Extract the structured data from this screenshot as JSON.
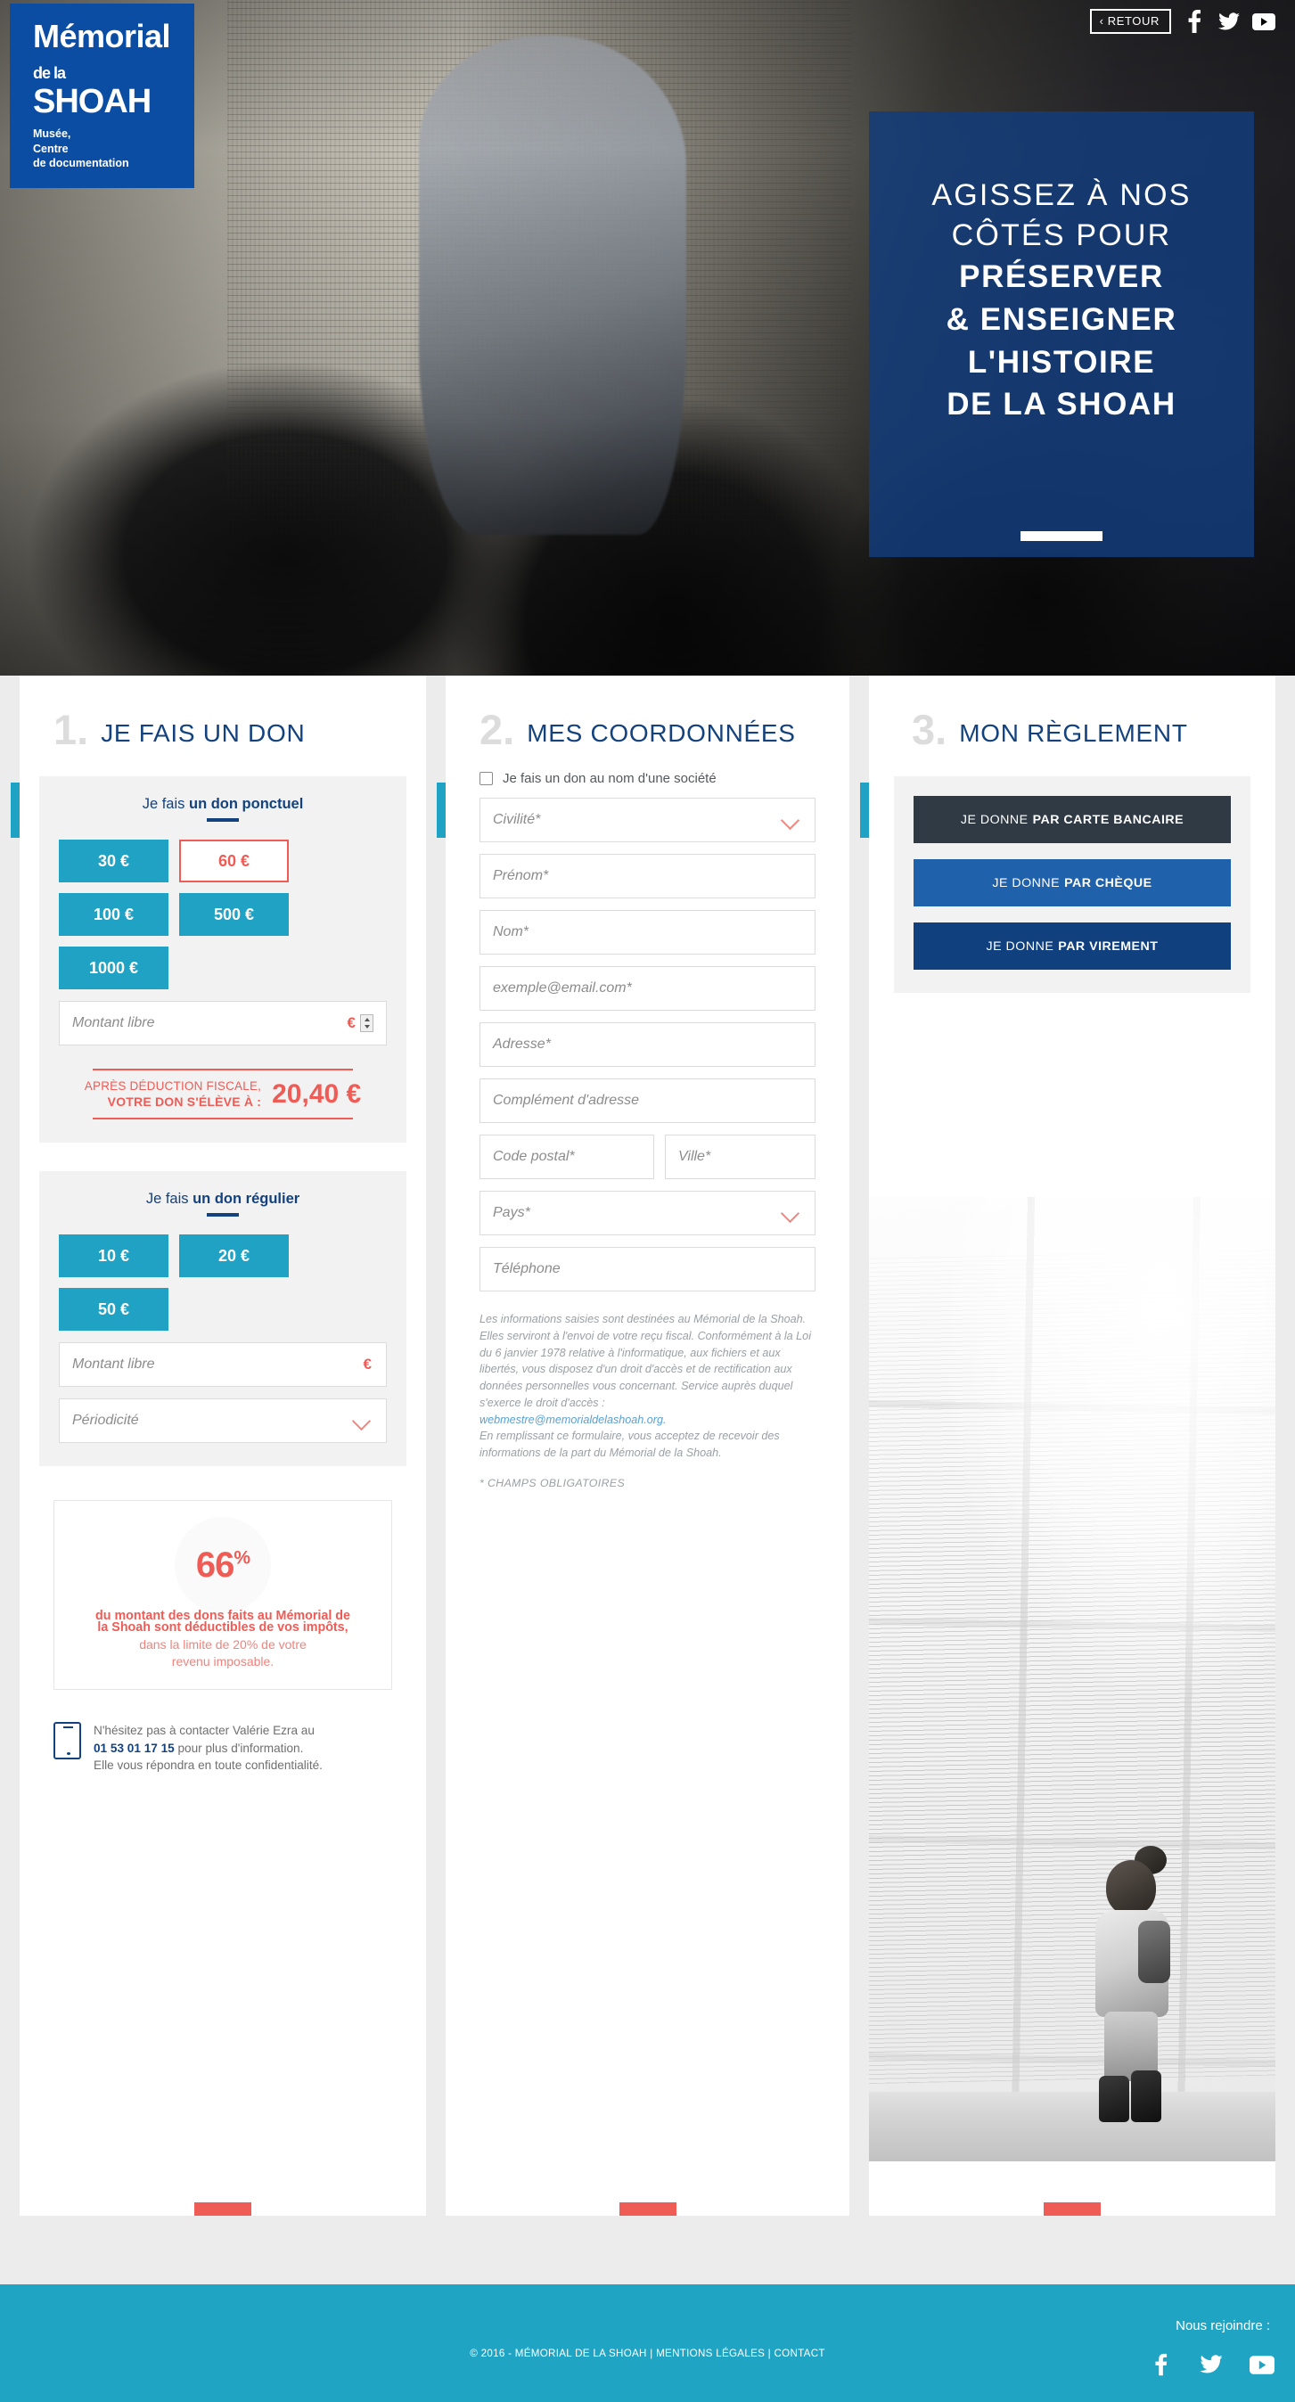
{
  "logo": {
    "line1": "Mémorial",
    "line2_small": "de la",
    "line2_big": "SHOAH",
    "sub_line1": "Musée,",
    "sub_line2": "Centre",
    "sub_line3": "de documentation"
  },
  "topnav": {
    "back_label": "‹ RETOUR",
    "social": [
      "facebook-icon",
      "twitter-icon",
      "youtube-icon"
    ]
  },
  "hero": {
    "line1": "AGISSEZ À NOS",
    "line2": "CÔTÉS POUR",
    "line3": "PRÉSERVER",
    "line4": "& ENSEIGNER",
    "line5": "L'HISTOIRE",
    "line6": "DE LA SHOAH"
  },
  "columns": {
    "col1": {
      "number": "1.",
      "title": "JE FAIS UN DON",
      "one_time": {
        "label_plain": "Je fais ",
        "label_bold": "un don ponctuel",
        "amounts": [
          "30 €",
          "60 €",
          "100 €",
          "500 €",
          "1000 €"
        ],
        "selected": "60 €",
        "free_amount_placeholder": "Montant libre",
        "currency_symbol": "€"
      },
      "deduction": {
        "line1": "APRÈS DÉDUCTION FISCALE,",
        "line2": "VOTRE DON S'ÉLÈVE À :",
        "value": "20,40 €"
      },
      "recurring": {
        "label_plain": "Je fais ",
        "label_bold": "un don régulier",
        "amounts": [
          "10 €",
          "20 €",
          "50 €"
        ],
        "free_amount_placeholder": "Montant libre",
        "currency_symbol": "€",
        "periodicity_placeholder": "Périodicité"
      },
      "tax_box": {
        "percent": "66",
        "percent_sign": "%",
        "bold_line1": "du montant des dons faits au Mémorial de",
        "bold_line2": "la Shoah sont déductibles de vos impôts,",
        "light_line1": "dans la limite de 20% de votre",
        "light_line2": "revenu imposable."
      },
      "contact": {
        "icon": "mobile-phone-icon",
        "line1": "N'hésitez pas à contacter Valérie Ezra au",
        "phone": "01 53 01 17 15",
        "line2_rest": " pour plus d'information.",
        "line3": "Elle vous répondra en toute confidentialité."
      }
    },
    "col2": {
      "number": "2.",
      "title": "MES COORDONNÉES",
      "company_checkbox_label": "Je fais un don au nom d'une société",
      "fields": {
        "civilite": "Civilité*",
        "prenom": "Prénom*",
        "nom": "Nom*",
        "email": "exemple@email.com*",
        "adresse": "Adresse*",
        "complement": "Complément d'adresse",
        "code_postal": "Code postal*",
        "ville": "Ville*",
        "pays": "Pays*",
        "telephone": "Téléphone"
      },
      "legal_part1": "Les informations saisies sont destinées au Mémorial de la Shoah. Elles serviront à l'envoi de votre reçu fiscal. Conformément à la Loi du 6 janvier 1978 relative à l'informatique, aux fichiers et aux libertés, vous disposez d'un droit d'accès et de rectification aux données personnelles vous concernant. Service auprès duquel s'exerce le droit d'accès : ",
      "legal_email": "webmestre@memorialdelashoah.org.",
      "legal_part2": "En remplissant ce formulaire, vous acceptez de recevoir des informations de la part du Mémorial de la Shoah.",
      "mandatory": "* CHAMPS OBLIGATOIRES"
    },
    "col3": {
      "number": "3.",
      "title": "MON RÈGLEMENT",
      "payments": [
        {
          "prefix": "JE DONNE ",
          "bold": "PAR CARTE BANCAIRE",
          "color": "#2f3a45"
        },
        {
          "prefix": "JE DONNE ",
          "bold": "PAR CHÈQUE",
          "color": "#2061ab"
        },
        {
          "prefix": "JE DONNE ",
          "bold": "PAR VIREMENT",
          "color": "#10407e"
        }
      ]
    }
  },
  "footer": {
    "copyright": "© 2016 - MÉMORIAL DE LA SHOAH | MENTIONS LÉGALES | CONTACT",
    "join_label": "Nous rejoindre :",
    "social": [
      "facebook-icon",
      "twitter-icon",
      "youtube-icon"
    ]
  },
  "colors": {
    "teal": "#1fa2c4",
    "deep_blue": "#13427f",
    "logo_blue": "#0b4da2",
    "coral": "#ef5b55",
    "dark_slate": "#2f3a45"
  }
}
